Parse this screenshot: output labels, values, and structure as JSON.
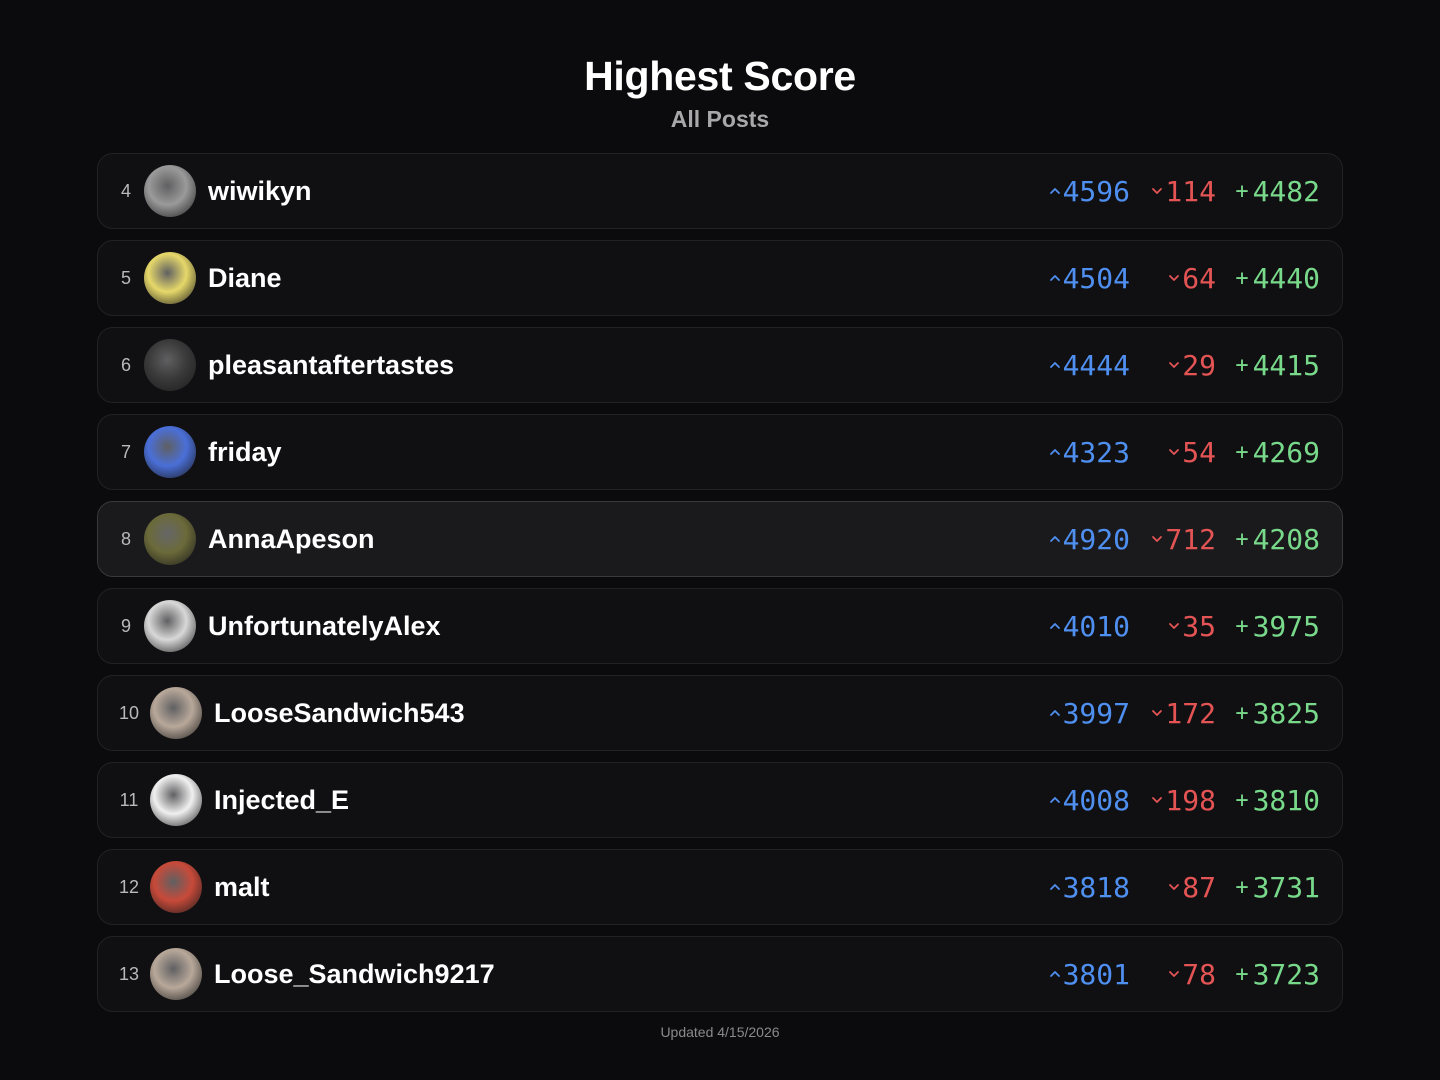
{
  "header": {
    "title": "Highest Score",
    "subtitle": "All Posts"
  },
  "rows": [
    {
      "rank": "4",
      "name": "wiwikyn",
      "up": "4596",
      "down": "114",
      "net": "4482",
      "avatar_color": "#9a9a9a",
      "highlighted": false
    },
    {
      "rank": "5",
      "name": "Diane",
      "up": "4504",
      "down": "64",
      "net": "4440",
      "avatar_color": "#e6d86a",
      "highlighted": false
    },
    {
      "rank": "6",
      "name": "pleasantaftertastes",
      "up": "4444",
      "down": "29",
      "net": "4415",
      "avatar_color": "#3a3a3a",
      "highlighted": false
    },
    {
      "rank": "7",
      "name": "friday",
      "up": "4323",
      "down": "54",
      "net": "4269",
      "avatar_color": "#4a6fd8",
      "highlighted": false
    },
    {
      "rank": "8",
      "name": "AnnaApeson",
      "up": "4920",
      "down": "712",
      "net": "4208",
      "avatar_color": "#6b6a3a",
      "highlighted": true
    },
    {
      "rank": "9",
      "name": "UnfortunatelyAlex",
      "up": "4010",
      "down": "35",
      "net": "3975",
      "avatar_color": "#d8d8d8",
      "highlighted": false
    },
    {
      "rank": "10",
      "name": "LooseSandwich543",
      "up": "3997",
      "down": "172",
      "net": "3825",
      "avatar_color": "#b8a89a",
      "highlighted": false
    },
    {
      "rank": "11",
      "name": "Injected_E",
      "up": "4008",
      "down": "198",
      "net": "3810",
      "avatar_color": "#f0f0f0",
      "highlighted": false
    },
    {
      "rank": "12",
      "name": "malt",
      "up": "3818",
      "down": "87",
      "net": "3731",
      "avatar_color": "#c84a3a",
      "highlighted": false
    },
    {
      "rank": "13",
      "name": "Loose_Sandwich9217",
      "up": "3801",
      "down": "78",
      "net": "3723",
      "avatar_color": "#b8a89a",
      "highlighted": false
    }
  ],
  "footer": {
    "updated": "Updated 4/15/2026"
  },
  "colors": {
    "upvote": "#4f8ff0",
    "downvote": "#e45454",
    "net": "#79d98b"
  },
  "icons": {
    "upvote": "chevron-up-icon",
    "downvote": "chevron-down-icon"
  }
}
